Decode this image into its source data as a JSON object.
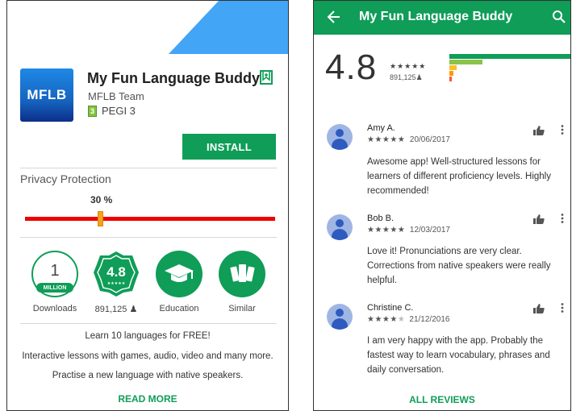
{
  "left": {
    "app_icon_text": "MFLB",
    "title": "My Fun Language Buddy",
    "developer": "MFLB Team",
    "pegi_badge": "3",
    "pegi_label": "PEGI 3",
    "install_label": "INSTALL",
    "privacy_label": "Privacy Protection",
    "privacy_percent_text": "30 %",
    "privacy_percent": 0.3,
    "stats": {
      "downloads_number": "1",
      "downloads_badge": "MILLION",
      "downloads_label": "Downloads",
      "rating_value": "4.8",
      "rating_stars": "★★★★★",
      "rating_count": "891,125",
      "education_label": "Education",
      "similar_label": "Similar"
    },
    "description": [
      "Learn 10 languages for FREE!",
      "Interactive lessons with games, audio, video and many more.",
      "Practise a new language with native speakers."
    ],
    "read_more": "READ MORE"
  },
  "right": {
    "toolbar_title": "My Fun Language Buddy",
    "rating": "4.8",
    "stars": "★★★★★",
    "rating_count": "891,125",
    "distribution": [
      {
        "stars": 5,
        "fraction": 1.0,
        "color": "#0f9d58"
      },
      {
        "stars": 4,
        "fraction": 0.27,
        "color": "#8bc34a"
      },
      {
        "stars": 3,
        "fraction": 0.06,
        "color": "#fbc02d"
      },
      {
        "stars": 2,
        "fraction": 0.03,
        "color": "#ff9800"
      },
      {
        "stars": 1,
        "fraction": 0.015,
        "color": "#ff5722"
      }
    ],
    "reviews": [
      {
        "name": "Amy A.",
        "stars": "★★★★★",
        "date": "20/06/2017",
        "text": "Awesome app! Well-structured lessons for learners of different proficiency levels. Highly recommended!"
      },
      {
        "name": "Bob B.",
        "stars": "★★★★★",
        "date": "12/03/2017",
        "text": "Love it! Pronunciations are very clear. Corrections from native speakers were really helpful."
      },
      {
        "name": "Christine C.",
        "stars": "★★★★",
        "stars_empty": "★",
        "date": "21/12/2016",
        "text": "I am very happy with the app. Probably the fastest way to learn vocabulary, phrases and daily conversation."
      }
    ],
    "all_reviews": "ALL REVIEWS"
  },
  "colors": {
    "accent_green": "#0f9d58",
    "header_blue": "#42a5f5",
    "privacy_bar": "#ee0000",
    "privacy_thumb": "#f6a21b"
  }
}
